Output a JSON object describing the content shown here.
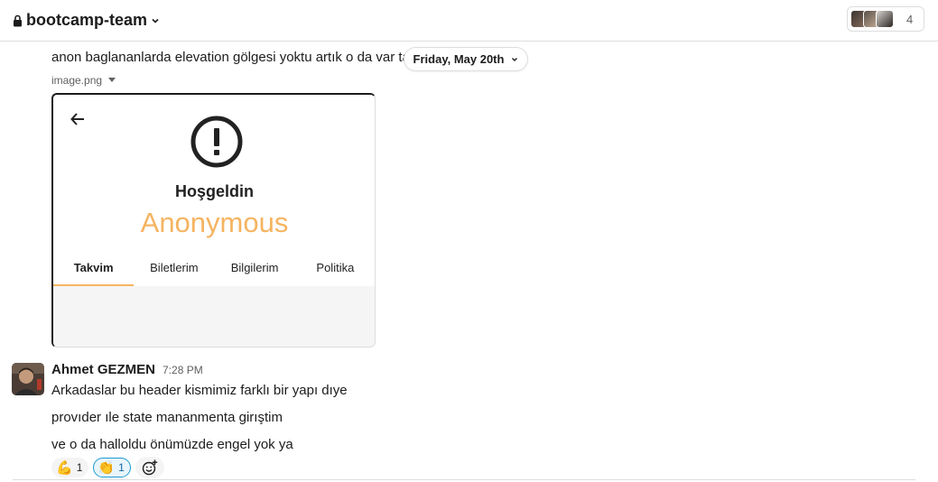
{
  "header": {
    "channel_name": "bootcamp-team",
    "member_count": "4"
  },
  "previous_message": {
    "text": "anon baglananlarda elevation gölgesi yoktu artık o da var tab",
    "attachment_name": "image.png",
    "attachment": {
      "welcome_text": "Hoşgeldin",
      "name_text": "Anonymous",
      "tabs": [
        "Takvim",
        "Biletlerim",
        "Bilgilerim",
        "Politika"
      ],
      "active_tab": "Takvim",
      "accent_color": "#f5b461"
    }
  },
  "date_divider": {
    "label": "Friday, May 20th"
  },
  "message": {
    "author": "Ahmet GEZMEN",
    "time": "7:28 PM",
    "lines": [
      "Arkadaslar bu header kismimiz farklı bir yapı dıye",
      "provıder ıle state mananmenta girıştim",
      "ve o da halloldu önümüzde engel yok ya"
    ],
    "reactions": [
      {
        "emoji": "💪",
        "count": "1",
        "active": false
      },
      {
        "emoji": "👏",
        "count": "1",
        "active": true
      }
    ]
  }
}
